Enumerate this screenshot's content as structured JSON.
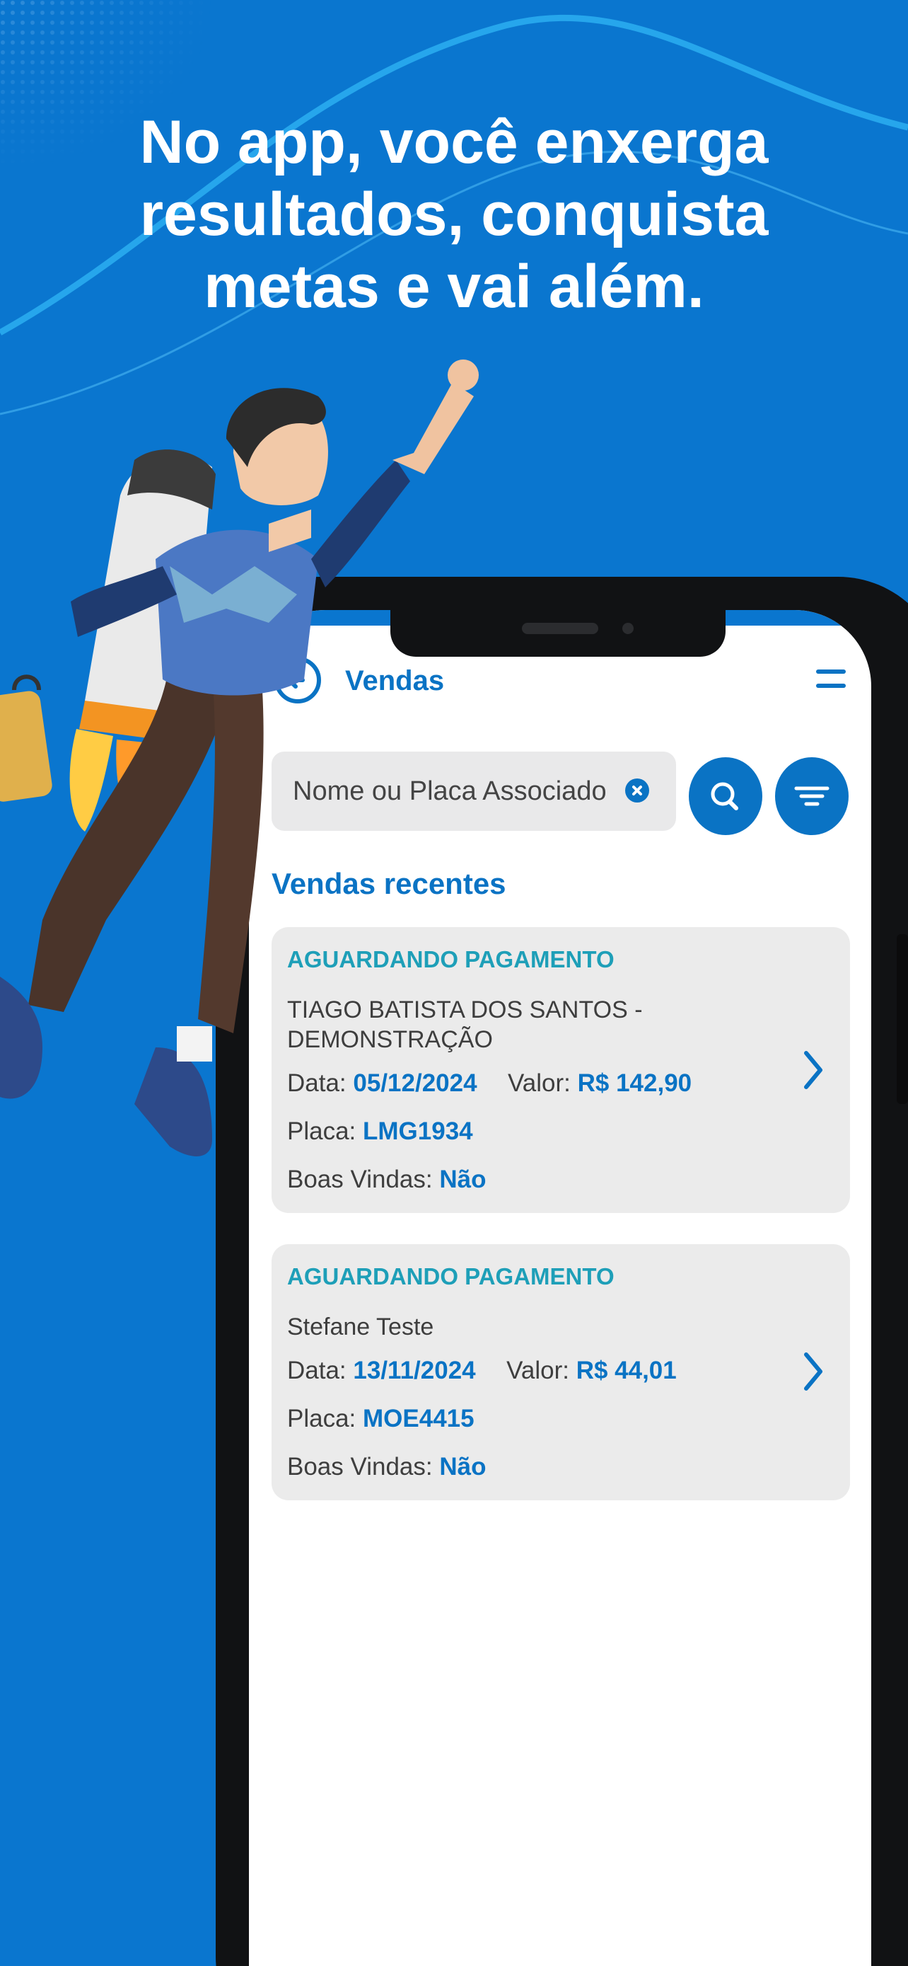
{
  "headline": {
    "line1": "No app, você enxerga",
    "line2": "resultados, conquista",
    "line3": "metas e vai além."
  },
  "app": {
    "title": "Vendas",
    "search": {
      "placeholder": "Nome ou Placa Associado"
    },
    "section_title": "Vendas recentes",
    "sales": [
      {
        "status": "AGUARDANDO PAGAMENTO",
        "name": "TIAGO BATISTA DOS SANTOS - DEMONSTRAÇÃO",
        "data_label": "Data:",
        "data_value": "05/12/2024",
        "valor_label": "Valor:",
        "valor_value": "R$ 142,90",
        "placa_label": "Placa:",
        "placa_value": "LMG1934",
        "boas_vindas_label": "Boas Vindas:",
        "boas_vindas_value": "Não"
      },
      {
        "status": "AGUARDANDO PAGAMENTO",
        "name": "Stefane Teste",
        "data_label": "Data:",
        "data_value": "13/11/2024",
        "valor_label": "Valor:",
        "valor_value": "R$ 44,01",
        "placa_label": "Placa:",
        "placa_value": "MOE4415",
        "boas_vindas_label": "Boas Vindas:",
        "boas_vindas_value": "Não"
      }
    ]
  },
  "icons": {
    "back": "arrow-left-circle-icon",
    "menu": "menu-icon",
    "clear": "close-circle-icon",
    "search": "search-icon",
    "filter": "filter-icon",
    "chevron": "chevron-right-icon"
  },
  "colors": {
    "background": "#0a76cf",
    "primary": "#0a73c4",
    "status": "#1e9fb8",
    "card": "#ebebeb",
    "text": "#3e3e3e",
    "headline": "#ffffff"
  }
}
